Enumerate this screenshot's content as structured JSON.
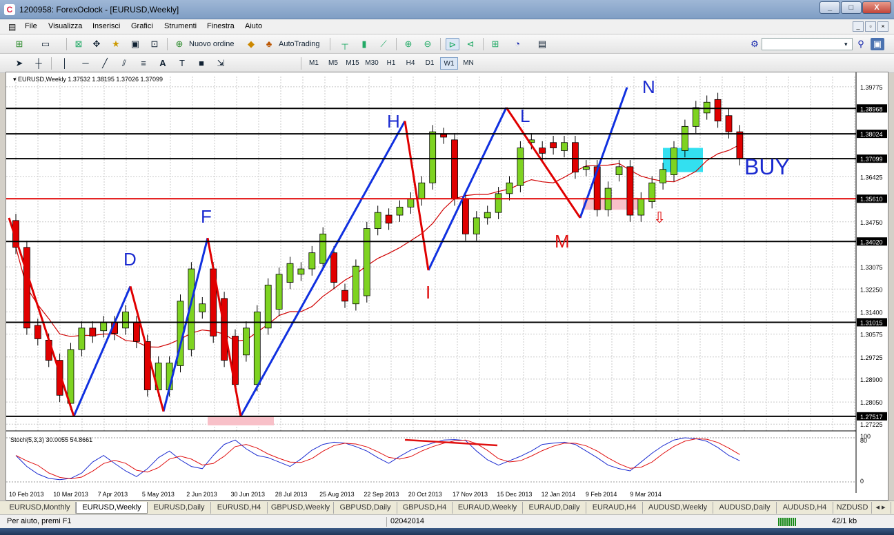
{
  "window": {
    "title": "1200958: ForexOclock - [EURUSD,Weekly]",
    "min": "_",
    "max": "□",
    "close": "X"
  },
  "menu": [
    "File",
    "Visualizza",
    "Inserisci",
    "Grafici",
    "Strumenti",
    "Finestra",
    "Aiuto"
  ],
  "toolbar": {
    "new_order": "Nuovo ordine",
    "autotrading": "AutoTrading",
    "timeframes": [
      "M1",
      "M5",
      "M15",
      "M30",
      "H1",
      "H4",
      "D1",
      "W1",
      "MN"
    ],
    "active_timeframe": "W1",
    "text_tool": "A"
  },
  "chart": {
    "header": "EURUSD,Weekly  1.37532 1.38195 1.37026 1.37099",
    "stoch_label": "Stoch(5,3,3) 30.0055 54.8661",
    "price_axis": [
      "1.39775",
      "1.38968",
      "1.38024",
      "1.37099",
      "1.36425",
      "1.35610",
      "1.34750",
      "1.34020",
      "1.33075",
      "1.32250",
      "1.31400",
      "1.31015",
      "1.30575",
      "1.29725",
      "1.28900",
      "1.28050",
      "1.27517",
      "1.27225"
    ],
    "highlighted_levels": [
      "1.38968",
      "1.38024",
      "1.37099",
      "1.35610",
      "1.34020",
      "1.31015",
      "1.27517"
    ],
    "stoch_axis": [
      "100",
      "80",
      "0"
    ],
    "date_axis": [
      "10 Feb 2013",
      "10 Mar 2013",
      "7 Apr 2013",
      "5 May 2013",
      "2 Jun 2013",
      "30 Jun 2013",
      "28 Jul 2013",
      "25 Aug 2013",
      "22 Sep 2013",
      "20 Oct 2013",
      "17 Nov 2013",
      "15 Dec 2013",
      "12 Jan 2014",
      "9 Feb 2014",
      "9 Mar 2014"
    ],
    "pattern_labels": [
      "D",
      "F",
      "H",
      "I",
      "L",
      "M",
      "N"
    ],
    "buy_label": "BUY",
    "colors": {
      "bull": "#7ed321",
      "bear": "#e00000",
      "pattern_blue": "#1030e0",
      "pattern_red": "#e00000",
      "ma": "#d00000",
      "buy_zone": "#33e0f0",
      "pink_zone": "#f8c0c8"
    }
  },
  "tabs": [
    "EURUSD,Monthly",
    "EURUSD,Weekly",
    "EURUSD,Daily",
    "EURUSD,H4",
    "GBPUSD,Weekly",
    "GBPUSD,Daily",
    "GBPUSD,H4",
    "EURAUD,Weekly",
    "EURAUD,Daily",
    "EURAUD,H4",
    "AUDUSD,Weekly",
    "AUDUSD,Daily",
    "AUDUSD,H4",
    "NZDUSD"
  ],
  "active_tab": "EURUSD,Weekly",
  "status": {
    "help": "Per aiuto, premi F1",
    "profile": "02042014",
    "traffic": "42/1 kb"
  }
}
